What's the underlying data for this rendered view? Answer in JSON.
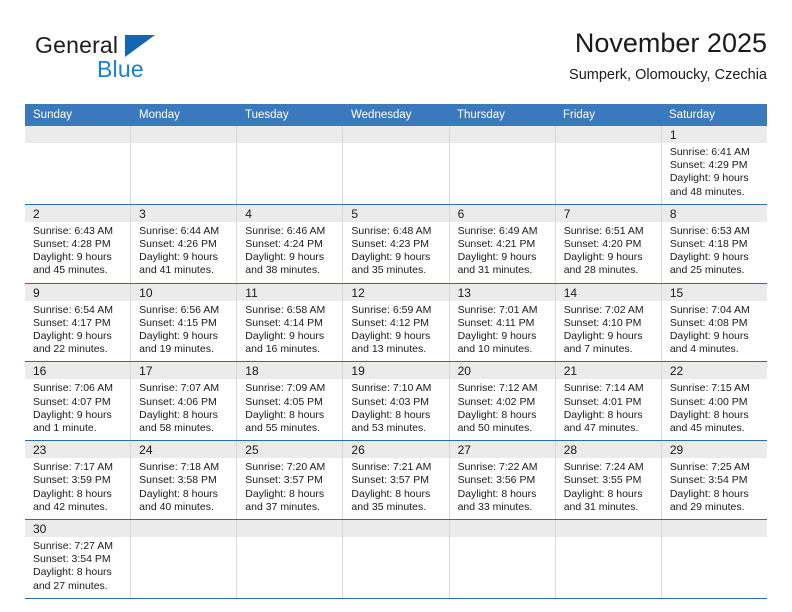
{
  "brand": {
    "name_top": "General",
    "name_bottom": "Blue",
    "accent_color": "#1267b2",
    "blue_text_color": "#1b7fd4"
  },
  "header": {
    "title": "November 2025",
    "subtitle": "Sumperk, Olomoucky, Czechia"
  },
  "theme": {
    "header_row_bg": "#3b79bf",
    "week_separator": "#2e6cab",
    "daynum_band_bg": "#ebebeb",
    "cell_border": "#d8d8d8"
  },
  "weekdays": [
    "Sunday",
    "Monday",
    "Tuesday",
    "Wednesday",
    "Thursday",
    "Friday",
    "Saturday"
  ],
  "weeks": [
    [
      {
        "day": "",
        "empty": true
      },
      {
        "day": "",
        "empty": true
      },
      {
        "day": "",
        "empty": true
      },
      {
        "day": "",
        "empty": true
      },
      {
        "day": "",
        "empty": true
      },
      {
        "day": "",
        "empty": true
      },
      {
        "day": "1",
        "sunrise": "Sunrise: 6:41 AM",
        "sunset": "Sunset: 4:29 PM",
        "daylight_1": "Daylight: 9 hours",
        "daylight_2": "and 48 minutes."
      }
    ],
    [
      {
        "day": "2",
        "sunrise": "Sunrise: 6:43 AM",
        "sunset": "Sunset: 4:28 PM",
        "daylight_1": "Daylight: 9 hours",
        "daylight_2": "and 45 minutes."
      },
      {
        "day": "3",
        "sunrise": "Sunrise: 6:44 AM",
        "sunset": "Sunset: 4:26 PM",
        "daylight_1": "Daylight: 9 hours",
        "daylight_2": "and 41 minutes."
      },
      {
        "day": "4",
        "sunrise": "Sunrise: 6:46 AM",
        "sunset": "Sunset: 4:24 PM",
        "daylight_1": "Daylight: 9 hours",
        "daylight_2": "and 38 minutes."
      },
      {
        "day": "5",
        "sunrise": "Sunrise: 6:48 AM",
        "sunset": "Sunset: 4:23 PM",
        "daylight_1": "Daylight: 9 hours",
        "daylight_2": "and 35 minutes."
      },
      {
        "day": "6",
        "sunrise": "Sunrise: 6:49 AM",
        "sunset": "Sunset: 4:21 PM",
        "daylight_1": "Daylight: 9 hours",
        "daylight_2": "and 31 minutes."
      },
      {
        "day": "7",
        "sunrise": "Sunrise: 6:51 AM",
        "sunset": "Sunset: 4:20 PM",
        "daylight_1": "Daylight: 9 hours",
        "daylight_2": "and 28 minutes."
      },
      {
        "day": "8",
        "sunrise": "Sunrise: 6:53 AM",
        "sunset": "Sunset: 4:18 PM",
        "daylight_1": "Daylight: 9 hours",
        "daylight_2": "and 25 minutes."
      }
    ],
    [
      {
        "day": "9",
        "sunrise": "Sunrise: 6:54 AM",
        "sunset": "Sunset: 4:17 PM",
        "daylight_1": "Daylight: 9 hours",
        "daylight_2": "and 22 minutes."
      },
      {
        "day": "10",
        "sunrise": "Sunrise: 6:56 AM",
        "sunset": "Sunset: 4:15 PM",
        "daylight_1": "Daylight: 9 hours",
        "daylight_2": "and 19 minutes."
      },
      {
        "day": "11",
        "sunrise": "Sunrise: 6:58 AM",
        "sunset": "Sunset: 4:14 PM",
        "daylight_1": "Daylight: 9 hours",
        "daylight_2": "and 16 minutes."
      },
      {
        "day": "12",
        "sunrise": "Sunrise: 6:59 AM",
        "sunset": "Sunset: 4:12 PM",
        "daylight_1": "Daylight: 9 hours",
        "daylight_2": "and 13 minutes."
      },
      {
        "day": "13",
        "sunrise": "Sunrise: 7:01 AM",
        "sunset": "Sunset: 4:11 PM",
        "daylight_1": "Daylight: 9 hours",
        "daylight_2": "and 10 minutes."
      },
      {
        "day": "14",
        "sunrise": "Sunrise: 7:02 AM",
        "sunset": "Sunset: 4:10 PM",
        "daylight_1": "Daylight: 9 hours",
        "daylight_2": "and 7 minutes."
      },
      {
        "day": "15",
        "sunrise": "Sunrise: 7:04 AM",
        "sunset": "Sunset: 4:08 PM",
        "daylight_1": "Daylight: 9 hours",
        "daylight_2": "and 4 minutes."
      }
    ],
    [
      {
        "day": "16",
        "sunrise": "Sunrise: 7:06 AM",
        "sunset": "Sunset: 4:07 PM",
        "daylight_1": "Daylight: 9 hours",
        "daylight_2": "and 1 minute."
      },
      {
        "day": "17",
        "sunrise": "Sunrise: 7:07 AM",
        "sunset": "Sunset: 4:06 PM",
        "daylight_1": "Daylight: 8 hours",
        "daylight_2": "and 58 minutes."
      },
      {
        "day": "18",
        "sunrise": "Sunrise: 7:09 AM",
        "sunset": "Sunset: 4:05 PM",
        "daylight_1": "Daylight: 8 hours",
        "daylight_2": "and 55 minutes."
      },
      {
        "day": "19",
        "sunrise": "Sunrise: 7:10 AM",
        "sunset": "Sunset: 4:03 PM",
        "daylight_1": "Daylight: 8 hours",
        "daylight_2": "and 53 minutes."
      },
      {
        "day": "20",
        "sunrise": "Sunrise: 7:12 AM",
        "sunset": "Sunset: 4:02 PM",
        "daylight_1": "Daylight: 8 hours",
        "daylight_2": "and 50 minutes."
      },
      {
        "day": "21",
        "sunrise": "Sunrise: 7:14 AM",
        "sunset": "Sunset: 4:01 PM",
        "daylight_1": "Daylight: 8 hours",
        "daylight_2": "and 47 minutes."
      },
      {
        "day": "22",
        "sunrise": "Sunrise: 7:15 AM",
        "sunset": "Sunset: 4:00 PM",
        "daylight_1": "Daylight: 8 hours",
        "daylight_2": "and 45 minutes."
      }
    ],
    [
      {
        "day": "23",
        "sunrise": "Sunrise: 7:17 AM",
        "sunset": "Sunset: 3:59 PM",
        "daylight_1": "Daylight: 8 hours",
        "daylight_2": "and 42 minutes."
      },
      {
        "day": "24",
        "sunrise": "Sunrise: 7:18 AM",
        "sunset": "Sunset: 3:58 PM",
        "daylight_1": "Daylight: 8 hours",
        "daylight_2": "and 40 minutes."
      },
      {
        "day": "25",
        "sunrise": "Sunrise: 7:20 AM",
        "sunset": "Sunset: 3:57 PM",
        "daylight_1": "Daylight: 8 hours",
        "daylight_2": "and 37 minutes."
      },
      {
        "day": "26",
        "sunrise": "Sunrise: 7:21 AM",
        "sunset": "Sunset: 3:57 PM",
        "daylight_1": "Daylight: 8 hours",
        "daylight_2": "and 35 minutes."
      },
      {
        "day": "27",
        "sunrise": "Sunrise: 7:22 AM",
        "sunset": "Sunset: 3:56 PM",
        "daylight_1": "Daylight: 8 hours",
        "daylight_2": "and 33 minutes."
      },
      {
        "day": "28",
        "sunrise": "Sunrise: 7:24 AM",
        "sunset": "Sunset: 3:55 PM",
        "daylight_1": "Daylight: 8 hours",
        "daylight_2": "and 31 minutes."
      },
      {
        "day": "29",
        "sunrise": "Sunrise: 7:25 AM",
        "sunset": "Sunset: 3:54 PM",
        "daylight_1": "Daylight: 8 hours",
        "daylight_2": "and 29 minutes."
      }
    ],
    [
      {
        "day": "30",
        "sunrise": "Sunrise: 7:27 AM",
        "sunset": "Sunset: 3:54 PM",
        "daylight_1": "Daylight: 8 hours",
        "daylight_2": "and 27 minutes."
      },
      {
        "day": "",
        "empty": true
      },
      {
        "day": "",
        "empty": true
      },
      {
        "day": "",
        "empty": true
      },
      {
        "day": "",
        "empty": true
      },
      {
        "day": "",
        "empty": true
      },
      {
        "day": "",
        "empty": true
      }
    ]
  ]
}
